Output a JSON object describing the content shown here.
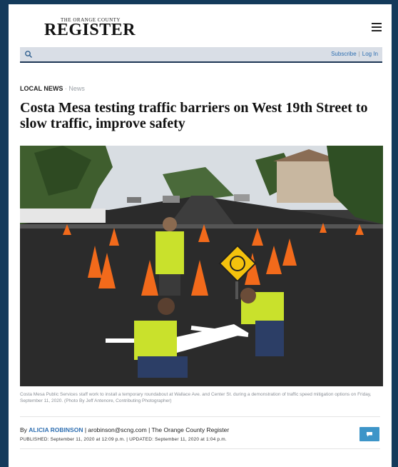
{
  "masthead": {
    "logo_top": "THE ORANGE COUNTY",
    "logo_main": "REGISTER",
    "menu_icon": "hamburger-icon"
  },
  "toolbar": {
    "search_icon": "search-icon",
    "subscribe": "Subscribe",
    "separator": "|",
    "login": "Log In"
  },
  "article": {
    "section": "LOCAL NEWS",
    "section_sep": " · ",
    "subsection": "News",
    "headline": "Costa Mesa testing traffic barriers on West 19th Street to slow traffic, improve safety",
    "caption": "Costa Mesa Public Services staff work to install a temporary roundabout at Wallace Ave. and Center St. during a demonstration of traffic speed mitigation options on Friday, September 11, 2020. (Photo By Jeff Antenore, Contributing Photographer)",
    "byline_prefix": "By ",
    "author": "ALICIA ROBINSON",
    "byline_rest": " | arobinson@scng.com | The Orange County Register",
    "dateline": "PUBLISHED: September 11, 2020 at 12:09 p.m. | UPDATED: September 11, 2020 at 1:04 p.m.",
    "comment_icon": "comment-icon"
  },
  "colors": {
    "background": "#143a5b",
    "accent": "#2f6fb1",
    "comment_button": "#3d95c8"
  }
}
